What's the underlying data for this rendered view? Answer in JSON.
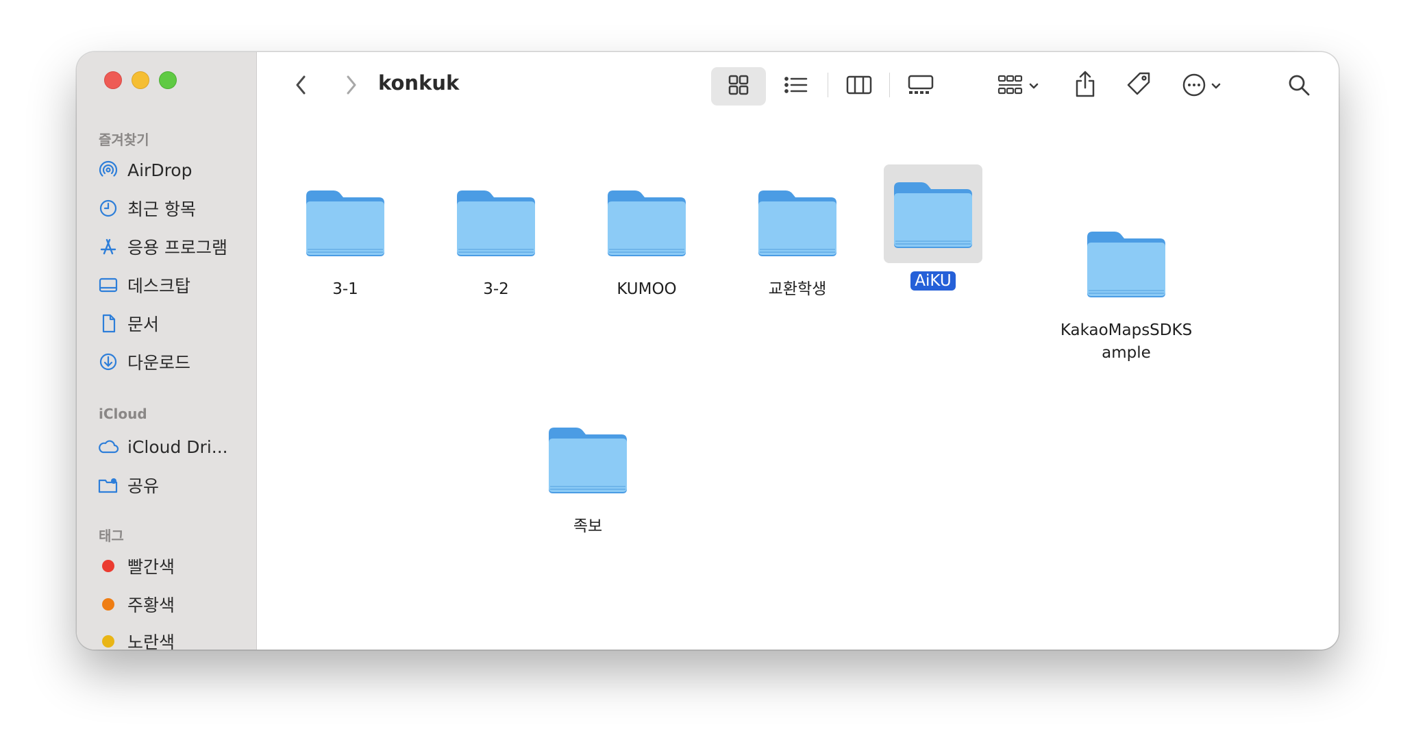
{
  "window": {
    "title": "konkuk"
  },
  "sidebar": {
    "favorites_title": "즐겨찾기",
    "favorites": [
      {
        "label": "AirDrop",
        "icon": "airdrop-icon"
      },
      {
        "label": "최근 항목",
        "icon": "clock-icon"
      },
      {
        "label": "응용 프로그램",
        "icon": "applications-icon"
      },
      {
        "label": "데스크탑",
        "icon": "desktop-icon"
      },
      {
        "label": "문서",
        "icon": "document-icon"
      },
      {
        "label": "다운로드",
        "icon": "download-icon"
      }
    ],
    "icloud_title": "iCloud",
    "icloud": [
      {
        "label": "iCloud Dri...",
        "icon": "cloud-icon"
      },
      {
        "label": "공유",
        "icon": "shared-folder-icon"
      }
    ],
    "tags_title": "태그",
    "tags": [
      {
        "label": "빨간색",
        "color": "#eb3b30"
      },
      {
        "label": "주황색",
        "color": "#ef7d13"
      },
      {
        "label": "노란색",
        "color": "#e9b516"
      }
    ]
  },
  "files": [
    {
      "name": "3-1",
      "selected": false
    },
    {
      "name": "3-2",
      "selected": false
    },
    {
      "name": "KUMOO",
      "selected": false
    },
    {
      "name": "교환학생",
      "selected": false
    },
    {
      "name": "AiKU",
      "selected": true
    },
    {
      "name": "KakaoMapsSDKSample",
      "selected": false
    },
    {
      "name": "족보",
      "selected": false
    }
  ],
  "colors": {
    "accent": "#2560d8",
    "folder": "#8ccbf6"
  }
}
